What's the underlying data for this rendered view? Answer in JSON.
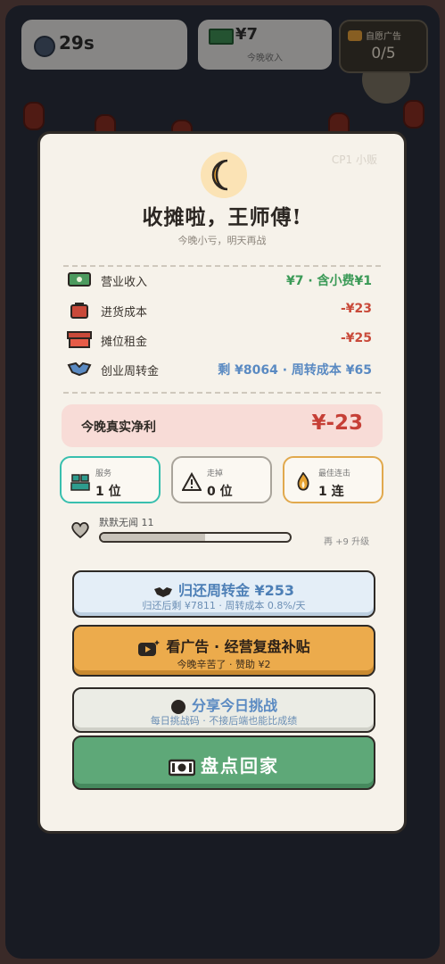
{
  "hud": {
    "timer": "29s",
    "earnings": "¥7",
    "earnings_label": "今晚收入",
    "ad_label": "自愿广告",
    "ad_count": "0/5"
  },
  "modal": {
    "watermark": "CP1 小贩",
    "title": "收摊啦，王师傅!",
    "subtitle": "今晚小亏，明天再战",
    "rows": [
      {
        "icon": "cash-icon",
        "label": "营业收入",
        "value": "¥7 · 含小费¥1",
        "color": "#3b9a57"
      },
      {
        "icon": "bag-icon",
        "label": "进货成本",
        "value": "-¥23",
        "color": "#c94a3a"
      },
      {
        "icon": "stall-icon",
        "label": "摊位租金",
        "value": "-¥25",
        "color": "#c94a3a"
      },
      {
        "icon": "handshake-icon",
        "label": "创业周转金",
        "value": "剩 ¥8064 · 周转成本 ¥65",
        "color": "#5a8ac2"
      }
    ],
    "profit_label": "今晚真实净利",
    "profit_value": "¥-23",
    "stats": [
      {
        "icon": "people-icon",
        "label": "服务",
        "value": "1 位"
      },
      {
        "icon": "warning-icon",
        "label": "走掉",
        "value": "0 位"
      },
      {
        "icon": "flame-icon",
        "label": "最佳连击",
        "value": "1 连"
      }
    ],
    "level": {
      "name": "默默无闻 11",
      "progress": 0.55,
      "next": "再 +9 升级"
    },
    "buttons": {
      "repay_title": "归还周转金 ¥253",
      "repay_sub": "归还后剩 ¥7811 · 周转成本 0.8%/天",
      "ad_title": "看广告 · 经营复盘补贴",
      "ad_sub": "今晚辛苦了 · 赞助 ¥2",
      "share_title": "分享今日挑战",
      "share_sub": "每日挑战码 · 不接后端也能比成绩",
      "home_title": "盘点回家"
    }
  },
  "colors": {
    "profit_red": "#c63f36",
    "accent_green": "#5ea878",
    "accent_orange": "#ecab4c"
  }
}
